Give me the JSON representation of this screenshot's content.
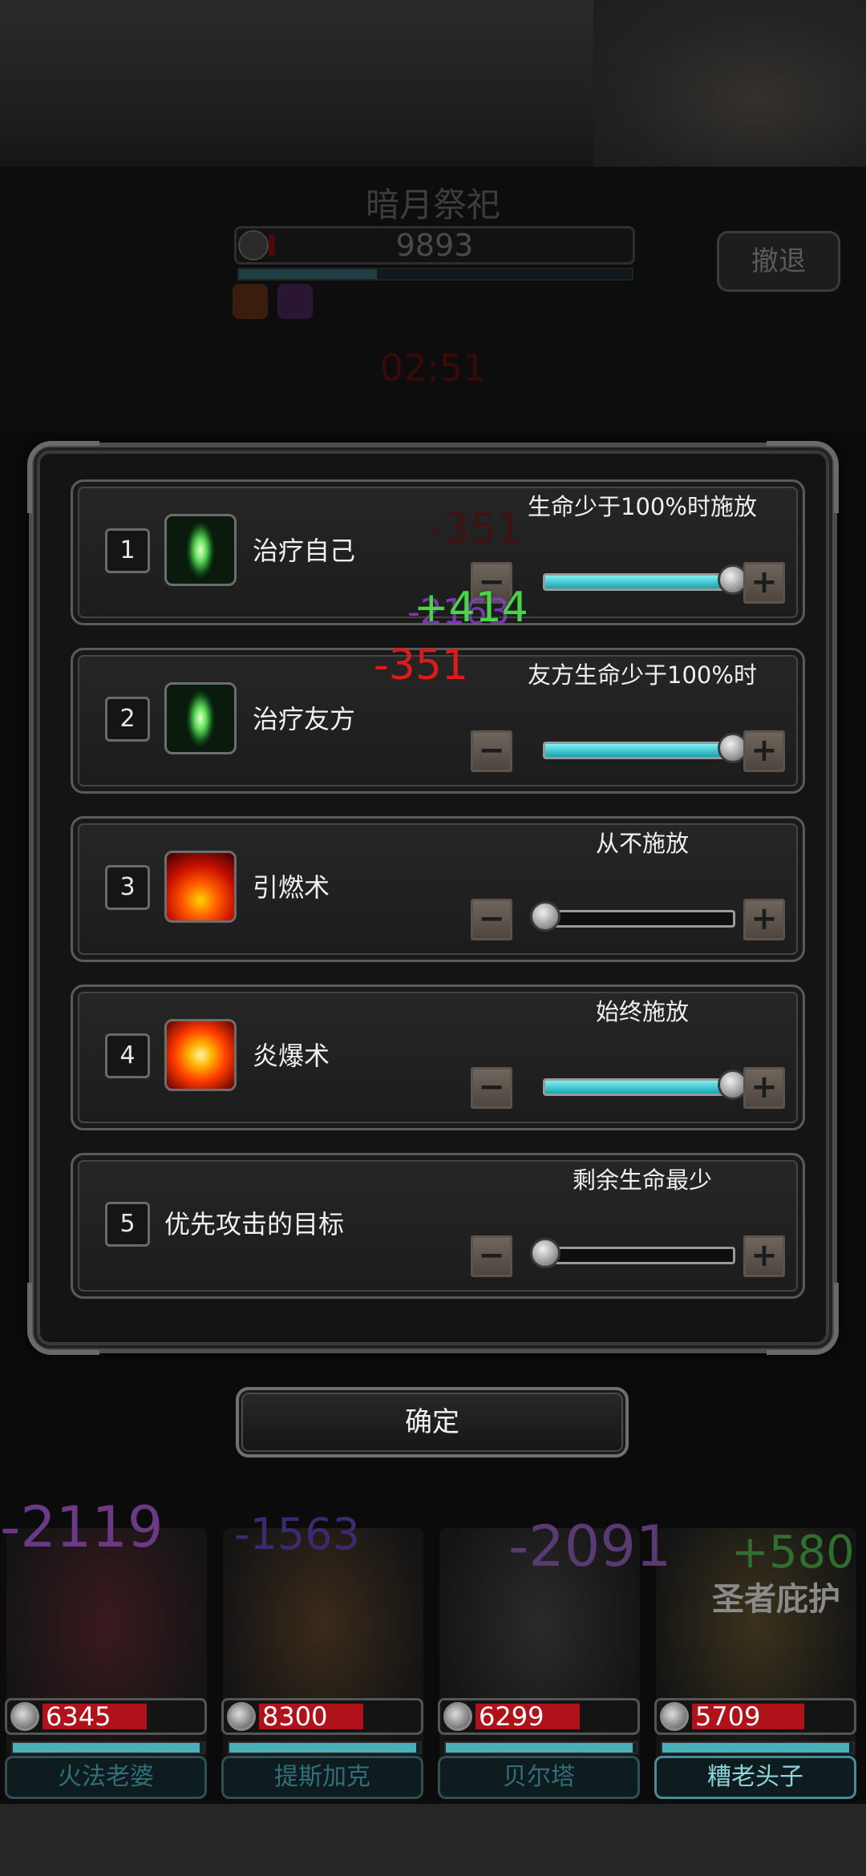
{
  "boss": {
    "name": "暗月祭祀",
    "hp": "9893",
    "timer": "02:51",
    "retreat_label": "撤退"
  },
  "dialog": {
    "rows": [
      {
        "num": "1",
        "icon": "heal-icon",
        "label": "治疗自己",
        "condition": "生命少于100%时施放",
        "slider": 1.0
      },
      {
        "num": "2",
        "icon": "heal-icon",
        "label": "治疗友方",
        "condition": "友方生命少于100%时",
        "slider": 1.0
      },
      {
        "num": "3",
        "icon": "ignite-icon",
        "label": "引燃术",
        "condition": "从不施放",
        "slider": 0.0
      },
      {
        "num": "4",
        "icon": "fire-burst-icon",
        "label": "炎爆术",
        "condition": "始终施放",
        "slider": 1.0
      },
      {
        "num": "5",
        "icon": "",
        "label": "优先攻击的目标",
        "condition": "剩余生命最少",
        "slider": 0.0
      }
    ],
    "minus_label": "−",
    "plus_label": "+",
    "confirm_label": "确定"
  },
  "floating_text": {
    "a": "-351",
    "b": "+414",
    "c": "-2163",
    "d": "-351"
  },
  "battle_text": {
    "dmg1": "-2119",
    "dmg2": "-1563",
    "dmg3": "-2091",
    "heal": "+580",
    "skill": "圣者庇护"
  },
  "heroes": [
    {
      "name": "火法老婆",
      "hp": "6345",
      "hp_frac": 0.65,
      "mp_frac": 0.98,
      "active": false
    },
    {
      "name": "提斯加克",
      "hp": "8300",
      "hp_frac": 0.65,
      "mp_frac": 0.98,
      "active": false
    },
    {
      "name": "贝尔塔",
      "hp": "6299",
      "hp_frac": 0.65,
      "mp_frac": 0.98,
      "active": false
    },
    {
      "name": "糟老头子",
      "hp": "5709",
      "hp_frac": 0.7,
      "mp_frac": 0.98,
      "active": true
    }
  ],
  "colors": {
    "slider_fill": "#17a3b0",
    "hp_fill": "#b0121a",
    "heal_text": "#4fd04f",
    "damage_text": "#e01a1a"
  }
}
